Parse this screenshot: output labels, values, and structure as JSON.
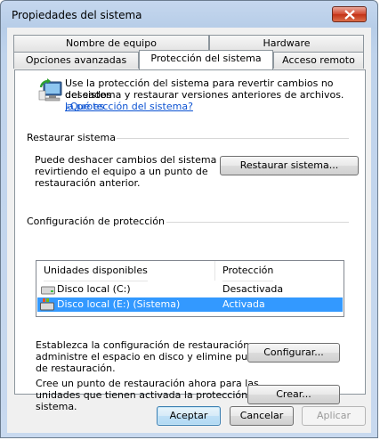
{
  "window": {
    "title": "Propiedades del sistema"
  },
  "tabs": {
    "row1": [
      "Nombre de equipo",
      "Hardware"
    ],
    "row2": [
      "Opciones avanzadas",
      "Protección del sistema",
      "Acceso remoto"
    ]
  },
  "info": {
    "text": "Use la protección del sistema para revertir cambios no deseados del sistema y restaurar versiones anteriores de archivos.",
    "line1": "Use la protección del sistema para revertir cambios no deseados",
    "line2": "del sistema y restaurar versiones anteriores de archivos.",
    "link_part1": "¿Qué es",
    "link_part2": "la protección del sistema?"
  },
  "restore": {
    "title": "Restaurar sistema",
    "line1": "Puede deshacer cambios del sistema",
    "line2": "revirtiendo el equipo a un punto de",
    "line3": "restauración anterior.",
    "button": "Restaurar sistema..."
  },
  "protection": {
    "title": "Configuración de protección",
    "columns": [
      "Unidades disponibles",
      "Protección"
    ],
    "drives": [
      {
        "name": "Disco local (C:)",
        "status": "Desactivada",
        "selected": false
      },
      {
        "name": "Disco local (E:) (Sistema)",
        "status": "Activada",
        "selected": true
      }
    ],
    "config_line1": "Establezca la configuración de restauración,",
    "config_line2": "administre el espacio en disco y elimine puntos",
    "config_line3": "de restauración.",
    "config_button": "Configurar...",
    "create_line1": "Cree un punto de restauración ahora para las",
    "create_line2": "unidades que tienen activada la protección del",
    "create_line3": "sistema.",
    "create_button": "Crear..."
  },
  "footer": {
    "ok": "Aceptar",
    "cancel": "Cancelar",
    "apply": "Aplicar"
  },
  "colors": {
    "selection": "#3399ff",
    "link": "#0b52d2",
    "close": "#c23116"
  }
}
